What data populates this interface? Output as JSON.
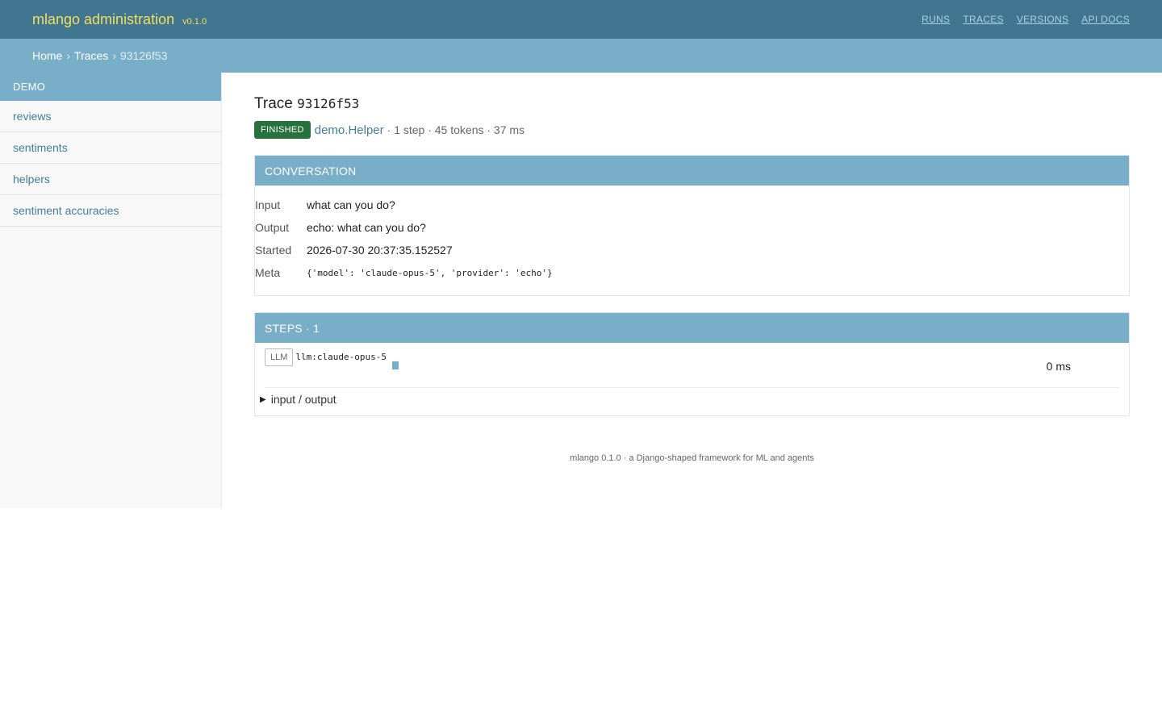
{
  "header": {
    "brand": "mlango administration",
    "version": "v0.1.0",
    "nav": [
      "RUNS",
      "TRACES",
      "VERSIONS",
      "API DOCS"
    ]
  },
  "breadcrumbs": {
    "home": "Home",
    "traces": "Traces",
    "current": "93126f53",
    "separator": "›"
  },
  "sidebar": {
    "caption": "DEMO",
    "items": [
      "reviews",
      "sentiments",
      "helpers",
      "sentiment accuracies"
    ]
  },
  "trace": {
    "title_prefix": "Trace",
    "id": "93126f53",
    "status": "FINISHED",
    "agent": "demo.Helper",
    "stats": "· 1 step · 45 tokens · 37 ms"
  },
  "conversation": {
    "caption": "CONVERSATION",
    "rows": [
      {
        "label": "Input",
        "value": "what can you do?"
      },
      {
        "label": "Output",
        "value": "echo: what can you do?"
      },
      {
        "label": "Started",
        "value": "2026-07-30 20:37:35.152527"
      },
      {
        "label": "Meta",
        "value": "{'model': 'claude-opus-5', 'provider': 'echo'}"
      }
    ]
  },
  "steps": {
    "caption": "STEPS · 1",
    "items": [
      {
        "kind": "LLM",
        "name": "llm:claude-opus-5",
        "duration": "0 ms"
      }
    ],
    "details_label": "input / output"
  },
  "footer": {
    "text": "mlango 0.1.0 · a Django-shaped framework for ML and agents"
  },
  "colors": {
    "header": "#417690",
    "accent": "#79aec8",
    "brand": "#f5dd5d",
    "status_finished": "#26713c",
    "link": "#447e9b"
  }
}
